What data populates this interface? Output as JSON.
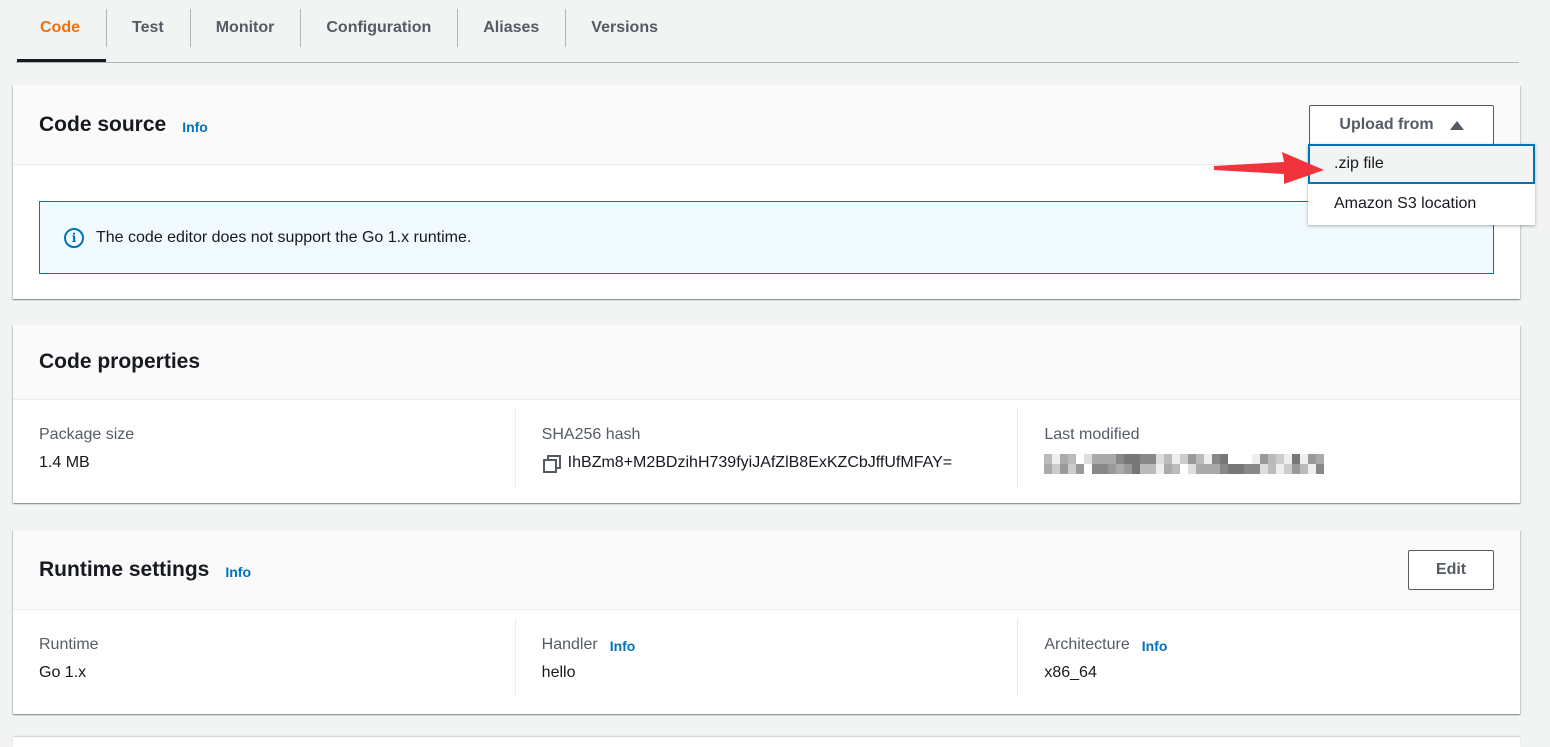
{
  "tabs": [
    {
      "label": "Code",
      "active": true
    },
    {
      "label": "Test",
      "active": false
    },
    {
      "label": "Monitor",
      "active": false
    },
    {
      "label": "Configuration",
      "active": false
    },
    {
      "label": "Aliases",
      "active": false
    },
    {
      "label": "Versions",
      "active": false
    }
  ],
  "code_source": {
    "title": "Code source",
    "info_label": "Info",
    "upload_button_label": "Upload from",
    "upload_menu": [
      ".zip file",
      "Amazon S3 location"
    ],
    "alert_text": "The code editor does not support the Go 1.x runtime."
  },
  "code_properties": {
    "title": "Code properties",
    "package_size_label": "Package size",
    "package_size_value": "1.4 MB",
    "hash_label": "SHA256 hash",
    "hash_value": "IhBZm8+M2BDzihH739fyiJAfZlB8ExKZCbJffUfMFAY=",
    "last_modified_label": "Last modified",
    "last_modified_value": "[redacted]"
  },
  "runtime_settings": {
    "title": "Runtime settings",
    "info_label": "Info",
    "edit_label": "Edit",
    "runtime_label": "Runtime",
    "runtime_value": "Go 1.x",
    "handler_label": "Handler",
    "handler_value": "hello",
    "architecture_label": "Architecture",
    "architecture_value": "x86_64"
  },
  "colors": {
    "active_tab": "#ec7211",
    "link": "#0073bb",
    "annotation_arrow": "#f0333d"
  }
}
